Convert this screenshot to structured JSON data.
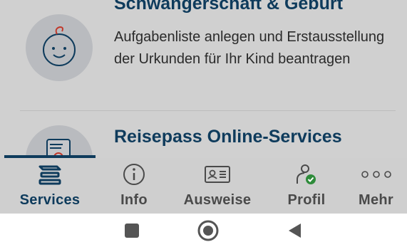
{
  "list": {
    "items": [
      {
        "title": "Schwangerschaft & Geburt",
        "description": "Aufgabenliste anlegen und Erstausstellung der Urkunden für Ihr Kind beantragen",
        "icon": "baby-face-icon"
      },
      {
        "title": "Reisepass Online-Services",
        "icon": "passport-icon"
      }
    ]
  },
  "tabbar": {
    "active": "Services",
    "tabs": [
      {
        "label": "Services",
        "icon": "services-stack-icon"
      },
      {
        "label": "Info",
        "icon": "info-icon"
      },
      {
        "label": "Ausweise",
        "icon": "id-card-icon"
      },
      {
        "label": "Profil",
        "icon": "profile-check-icon"
      },
      {
        "label": "Mehr",
        "icon": "more-dots-icon"
      }
    ]
  },
  "navbar": {
    "buttons": [
      "stop-square-icon",
      "home-circle-icon",
      "back-triangle-icon"
    ]
  },
  "colors": {
    "primary": "#0e3b5c",
    "overlay": "#d0d0d0",
    "verified": "#2e8b3a",
    "accent": "#c0392b"
  }
}
